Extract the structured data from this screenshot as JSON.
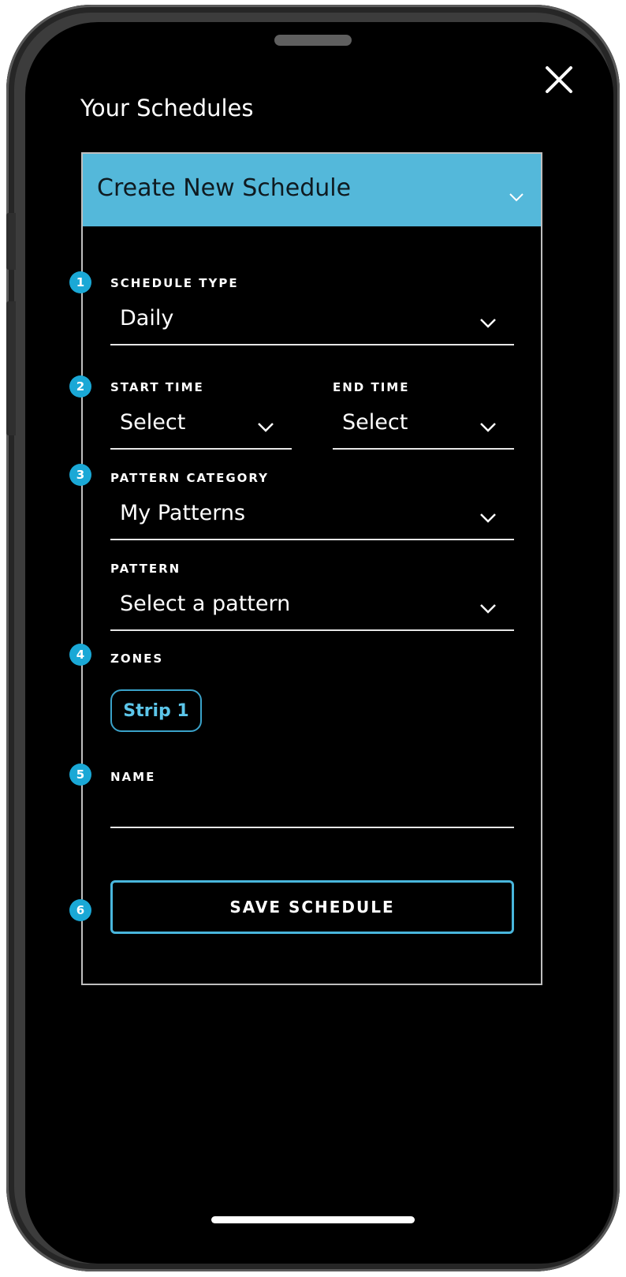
{
  "page_title": "Your Schedules",
  "card": {
    "title": "Create New Schedule"
  },
  "form": {
    "schedule_type": {
      "step": "1",
      "label": "SCHEDULE TYPE",
      "value": "Daily"
    },
    "start_time": {
      "step": "2",
      "label": "START TIME",
      "value": "Select"
    },
    "end_time": {
      "label": "END TIME",
      "value": "Select"
    },
    "pattern_category": {
      "step": "3",
      "label": "PATTERN CATEGORY",
      "value": "My Patterns"
    },
    "pattern": {
      "label": "PATTERN",
      "value": "Select a pattern"
    },
    "zones": {
      "step": "4",
      "label": "ZONES",
      "chip": "Strip 1"
    },
    "name": {
      "step": "5",
      "label": "NAME",
      "value": ""
    },
    "save": {
      "step": "6",
      "label": "SAVE SCHEDULE"
    }
  },
  "colors": {
    "accent": "#54b8da",
    "badge": "#1aa8d6",
    "background": "#000000"
  },
  "icons": {
    "close": "close-icon",
    "chevron": "chevron-down-icon"
  }
}
